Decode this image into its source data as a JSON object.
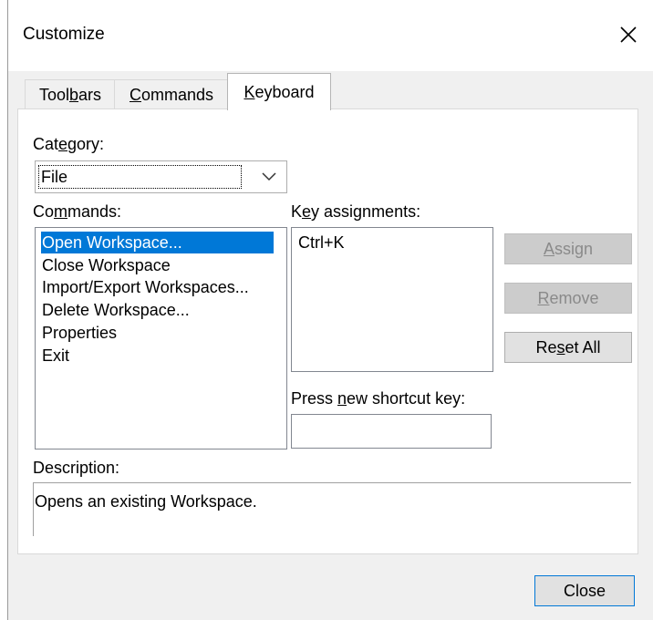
{
  "window": {
    "title": "Customize"
  },
  "tabs": [
    {
      "pre": "Tool",
      "accel": "b",
      "post": "ars"
    },
    {
      "pre": "",
      "accel": "C",
      "post": "ommands"
    },
    {
      "pre": "",
      "accel": "K",
      "post": "eyboard"
    }
  ],
  "active_tab": "Keyboard",
  "category": {
    "label_pre": "Cat",
    "label_accel": "e",
    "label_post": "gory:",
    "value": "File"
  },
  "commands": {
    "label_pre": "Co",
    "label_accel": "m",
    "label_post": "mands:",
    "items": [
      "Open Workspace...",
      "Close Workspace",
      "Import/Export Workspaces...",
      "Delete Workspace...",
      "Properties",
      "Exit"
    ],
    "selected_index": 0
  },
  "key_assignments": {
    "label_pre": "K",
    "label_accel": "e",
    "label_post": "y assignments:",
    "items": [
      "Ctrl+K"
    ]
  },
  "shortcut": {
    "label_pre": "Press ",
    "label_accel": "n",
    "label_post": "ew shortcut key:",
    "value": ""
  },
  "buttons": {
    "assign": {
      "pre": "",
      "accel": "A",
      "post": "ssign"
    },
    "remove": {
      "pre": "",
      "accel": "R",
      "post": "emove"
    },
    "reset_all": {
      "pre": "Re",
      "accel": "s",
      "post": "et All"
    },
    "close": "Close"
  },
  "description": {
    "label": "Description:",
    "text": "Opens an existing Workspace."
  }
}
